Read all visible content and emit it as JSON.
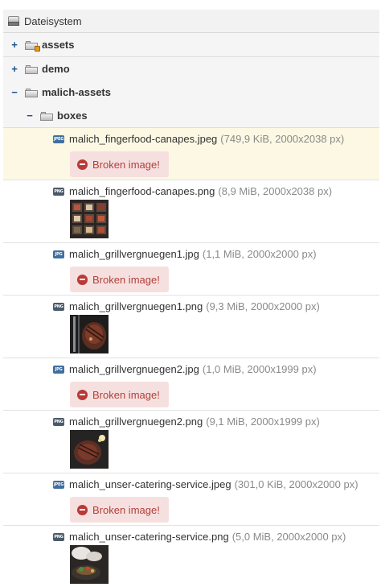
{
  "root": {
    "label": "Dateisystem"
  },
  "folders": [
    {
      "label": "assets",
      "toggle": "+",
      "locked": true
    },
    {
      "label": "demo",
      "toggle": "+"
    },
    {
      "label": "malich-assets",
      "toggle": "−"
    },
    {
      "label": "boxes",
      "toggle": "−"
    }
  ],
  "broken_label": "Broken image!",
  "files": [
    {
      "name": "malich_fingerfood-canapes.jpeg",
      "meta": "(749,9 KiB, 2000x2038 px)",
      "type": "jpeg",
      "icon_text": "JPEG",
      "preview": "broken"
    },
    {
      "name": "malich_fingerfood-canapes.png",
      "meta": "(8,9 MiB, 2000x2038 px)",
      "type": "png",
      "icon_text": "PNG",
      "preview": "canapes"
    },
    {
      "name": "malich_grillvergnuegen1.jpg",
      "meta": "(1,1 MiB, 2000x2000 px)",
      "type": "jpeg",
      "icon_text": "JPG",
      "preview": "broken"
    },
    {
      "name": "malich_grillvergnuegen1.png",
      "meta": "(9,3 MiB, 2000x2000 px)",
      "type": "png",
      "icon_text": "PNG",
      "preview": "steak1"
    },
    {
      "name": "malich_grillvergnuegen2.jpg",
      "meta": "(1,0 MiB, 2000x1999 px)",
      "type": "jpeg",
      "icon_text": "JPG",
      "preview": "broken"
    },
    {
      "name": "malich_grillvergnuegen2.png",
      "meta": "(9,1 MiB, 2000x1999 px)",
      "type": "png",
      "icon_text": "PNG",
      "preview": "steak2"
    },
    {
      "name": "malich_unser-catering-service.jpeg",
      "meta": "(301,0 KiB, 2000x2000 px)",
      "type": "jpeg",
      "icon_text": "JPEG",
      "preview": "broken"
    },
    {
      "name": "malich_unser-catering-service.png",
      "meta": "(5,0 MiB, 2000x2000 px)",
      "type": "png",
      "icon_text": "PNG",
      "preview": "catering"
    }
  ],
  "colors": {
    "selected_row": "#fcf8e3",
    "broken_bg": "#f6e0df",
    "broken_text": "#b0403c",
    "toggle": "#1a4f8b"
  }
}
